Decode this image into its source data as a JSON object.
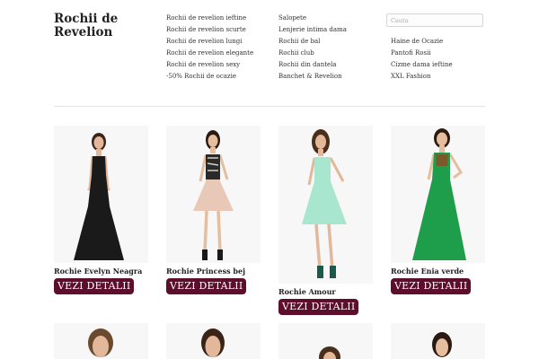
{
  "site": {
    "logo": "Rochii de Revelion"
  },
  "nav": {
    "col1": [
      "Rochii de revelion ieftine",
      "Rochii de revelion scurte",
      "Rochii de revelion lungi",
      "Rochii de revelion elegante",
      "Rochii de revelion sexy",
      "-50% Rochii de ocazie"
    ],
    "col2": [
      "Salopete",
      "Lenjerie intima dama",
      "Rochii de bal",
      "Rochii club",
      "Rochii din dantela",
      "Banchet & Revelion"
    ],
    "col3": [
      "Haine de Ocazie",
      "Pantofi Rosii",
      "Cizme dama ieftine",
      "XXL Fashion"
    ]
  },
  "search": {
    "placeholder": "Cauta",
    "value": ""
  },
  "products": [
    {
      "title": "Rochie Evelyn Neagra",
      "button": "VEZI DETALII",
      "dress_color": "#1a1a1a",
      "hair_color": "#3a2418"
    },
    {
      "title": "Rochie Princess bej",
      "button": "VEZI DETALII",
      "dress_color": "#e8c9b8",
      "hair_color": "#2a1a12"
    },
    {
      "title": "Rochie Amour",
      "button": "VEZI DETALII",
      "dress_color": "#a8e6cf",
      "hair_color": "#4a2e1c"
    },
    {
      "title": "Rochie Enia verde",
      "button": "VEZI DETALII",
      "dress_color": "#1e9e4a",
      "hair_color": "#2a1a12"
    }
  ],
  "colors": {
    "button_bg": "#5c0e2a",
    "button_text": "#ffffff"
  }
}
